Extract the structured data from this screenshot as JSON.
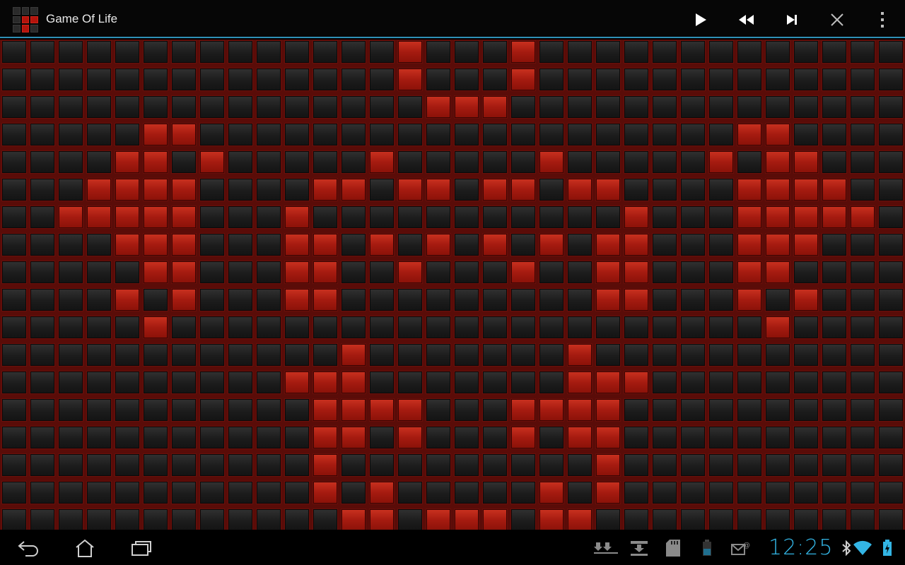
{
  "app": {
    "title": "Game Of Life",
    "icon": "game-of-life-app-icon"
  },
  "toolbar": {
    "actions": [
      {
        "name": "play-button",
        "icon": "play-icon"
      },
      {
        "name": "rewind-button",
        "icon": "rewind-icon"
      },
      {
        "name": "step-button",
        "icon": "step-forward-icon"
      },
      {
        "name": "clear-button",
        "icon": "close-icon"
      },
      {
        "name": "overflow-menu-button",
        "icon": "more-vert-icon"
      }
    ]
  },
  "board": {
    "columns": 32,
    "rows": 18,
    "colors": {
      "alive": "#b01a10",
      "dead": "#222222",
      "grid": "#6a0f0a"
    },
    "live_cells": [
      [
        0,
        14
      ],
      [
        0,
        18
      ],
      [
        1,
        14
      ],
      [
        1,
        18
      ],
      [
        2,
        15
      ],
      [
        2,
        16
      ],
      [
        2,
        17
      ],
      [
        3,
        5
      ],
      [
        3,
        6
      ],
      [
        3,
        26
      ],
      [
        3,
        27
      ],
      [
        4,
        4
      ],
      [
        4,
        5
      ],
      [
        4,
        7
      ],
      [
        4,
        13
      ],
      [
        4,
        19
      ],
      [
        4,
        25
      ],
      [
        4,
        27
      ],
      [
        4,
        28
      ],
      [
        5,
        3
      ],
      [
        5,
        4
      ],
      [
        5,
        5
      ],
      [
        5,
        6
      ],
      [
        5,
        11
      ],
      [
        5,
        12
      ],
      [
        5,
        14
      ],
      [
        5,
        15
      ],
      [
        5,
        17
      ],
      [
        5,
        18
      ],
      [
        5,
        20
      ],
      [
        5,
        21
      ],
      [
        5,
        26
      ],
      [
        5,
        27
      ],
      [
        5,
        28
      ],
      [
        5,
        29
      ],
      [
        6,
        2
      ],
      [
        6,
        3
      ],
      [
        6,
        4
      ],
      [
        6,
        5
      ],
      [
        6,
        6
      ],
      [
        6,
        10
      ],
      [
        6,
        22
      ],
      [
        6,
        26
      ],
      [
        6,
        27
      ],
      [
        6,
        28
      ],
      [
        6,
        29
      ],
      [
        6,
        30
      ],
      [
        7,
        4
      ],
      [
        7,
        5
      ],
      [
        7,
        6
      ],
      [
        7,
        10
      ],
      [
        7,
        11
      ],
      [
        7,
        13
      ],
      [
        7,
        15
      ],
      [
        7,
        17
      ],
      [
        7,
        19
      ],
      [
        7,
        21
      ],
      [
        7,
        22
      ],
      [
        7,
        26
      ],
      [
        7,
        27
      ],
      [
        7,
        28
      ],
      [
        8,
        5
      ],
      [
        8,
        6
      ],
      [
        8,
        10
      ],
      [
        8,
        11
      ],
      [
        8,
        14
      ],
      [
        8,
        18
      ],
      [
        8,
        21
      ],
      [
        8,
        22
      ],
      [
        8,
        26
      ],
      [
        8,
        27
      ],
      [
        9,
        4
      ],
      [
        9,
        6
      ],
      [
        9,
        10
      ],
      [
        9,
        11
      ],
      [
        9,
        21
      ],
      [
        9,
        22
      ],
      [
        9,
        26
      ],
      [
        9,
        28
      ],
      [
        10,
        5
      ],
      [
        10,
        27
      ],
      [
        11,
        12
      ],
      [
        11,
        20
      ],
      [
        12,
        10
      ],
      [
        12,
        11
      ],
      [
        12,
        12
      ],
      [
        12,
        20
      ],
      [
        12,
        21
      ],
      [
        12,
        22
      ],
      [
        13,
        11
      ],
      [
        13,
        12
      ],
      [
        13,
        13
      ],
      [
        13,
        14
      ],
      [
        13,
        18
      ],
      [
        13,
        19
      ],
      [
        13,
        20
      ],
      [
        13,
        21
      ],
      [
        14,
        11
      ],
      [
        14,
        12
      ],
      [
        14,
        14
      ],
      [
        14,
        18
      ],
      [
        14,
        20
      ],
      [
        14,
        21
      ],
      [
        15,
        11
      ],
      [
        15,
        21
      ],
      [
        16,
        11
      ],
      [
        16,
        13
      ],
      [
        16,
        19
      ],
      [
        16,
        21
      ],
      [
        17,
        12
      ],
      [
        17,
        13
      ],
      [
        17,
        15
      ],
      [
        17,
        16
      ],
      [
        17,
        17
      ],
      [
        17,
        19
      ],
      [
        17,
        20
      ]
    ]
  },
  "navbar": {
    "buttons": [
      {
        "name": "back-button",
        "icon": "back-icon"
      },
      {
        "name": "home-button",
        "icon": "home-icon"
      },
      {
        "name": "recent-apps-button",
        "icon": "recent-apps-icon"
      }
    ]
  },
  "status": {
    "time": "12:25",
    "accent": "#33b5e5",
    "icons": [
      "download-icon",
      "download-tray-icon",
      "sd-card-icon",
      "battery-small-icon",
      "email-icon",
      "bluetooth-icon",
      "wifi-icon",
      "battery-charging-icon"
    ]
  }
}
